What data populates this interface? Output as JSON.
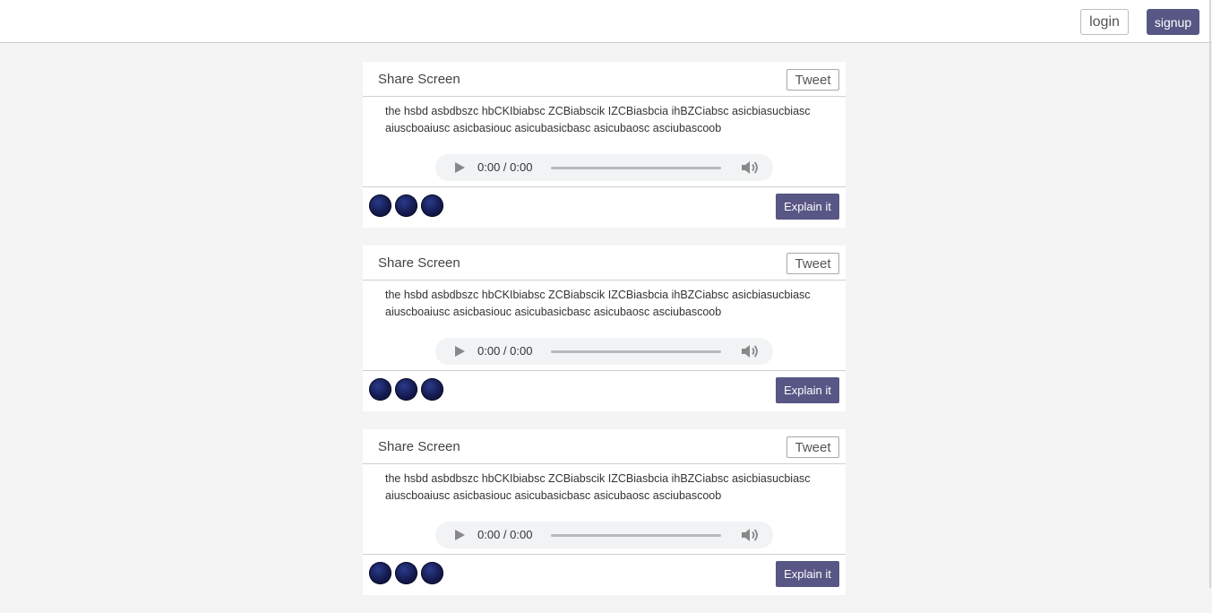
{
  "header": {
    "login_label": "login",
    "signup_label": "signup"
  },
  "posts": [
    {
      "title": "Share Screen",
      "tweet_label": "Tweet",
      "text": "the hsbd asbdbszc hbCKIbiabsc ZCBiabscik IZCBiasbcia ihBZCiabsc asicbiasucbiasc aiuscboaiusc asicbasiouc asicubasicbasc asicubaosc asciubascoob",
      "audio_time": "0:00 / 0:00",
      "explain_label": "Explain it"
    },
    {
      "title": "Share Screen",
      "tweet_label": "Tweet",
      "text": "the hsbd asbdbszc hbCKIbiabsc ZCBiabscik IZCBiasbcia ihBZCiabsc asicbiasucbiasc aiuscboaiusc asicbasiouc asicubasicbasc asicubaosc asciubascoob",
      "audio_time": "0:00 / 0:00",
      "explain_label": "Explain it"
    },
    {
      "title": "Share Screen",
      "tweet_label": "Tweet",
      "text": "the hsbd asbdbszc hbCKIbiabsc ZCBiabscik IZCBiasbcia ihBZCiabsc asicbiasucbiasc aiuscboaiusc asicbasiouc asicubasicbasc asicubaosc asciubascoob",
      "audio_time": "0:00 / 0:00",
      "explain_label": "Explain it"
    }
  ],
  "colors": {
    "accent": "#585684",
    "page_bg": "#f4f4f4",
    "card_bg": "#ffffff"
  },
  "icons": [
    "play-icon",
    "volume-icon",
    "avatar"
  ]
}
